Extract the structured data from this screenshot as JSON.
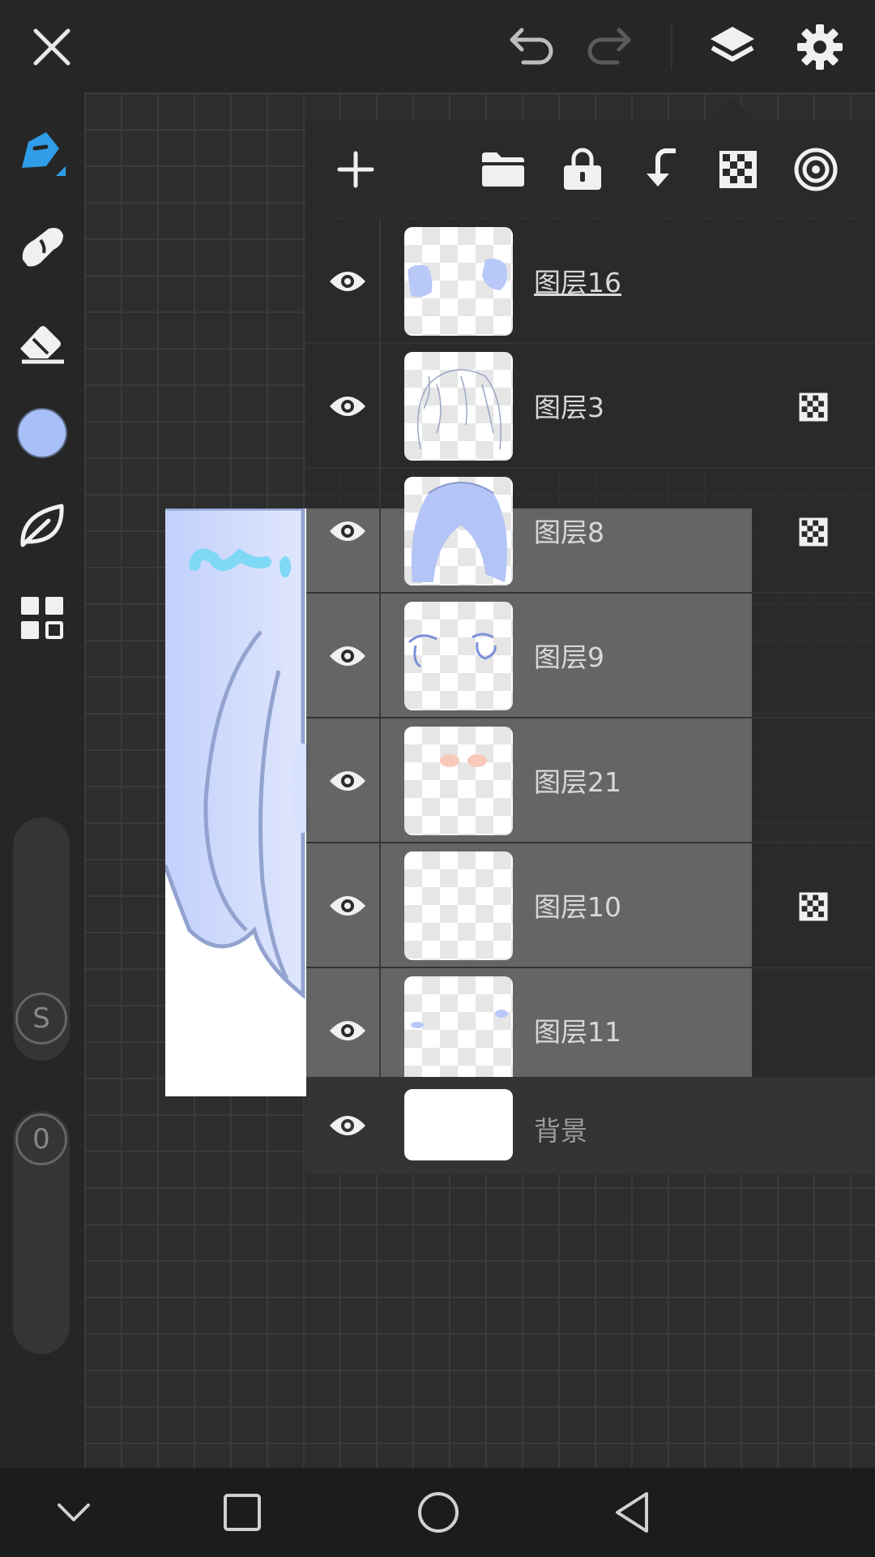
{
  "colors": {
    "accent": "#2f9de8",
    "current_color": "#a8bff7",
    "panel_bg": "#2a2a2a",
    "background": "#2d2d2d"
  },
  "topbar": {
    "icons": [
      "close-icon",
      "undo-icon",
      "redo-icon",
      "layers-icon",
      "settings-icon"
    ]
  },
  "left_toolbar": {
    "tools": [
      "pen-icon",
      "smudge-icon",
      "eraser-icon",
      "color-swatch",
      "leaf-icon",
      "grid-icon"
    ],
    "size_slider_label": "S",
    "opacity_slider_label": "0"
  },
  "layers_panel": {
    "toolbar_icons": [
      "add-layer-icon",
      "folder-icon",
      "lock-icon",
      "merge-down-icon",
      "alpha-lock-icon",
      "blend-icon"
    ],
    "layers": [
      {
        "name": "图层16",
        "selected": true,
        "alpha_lock": false
      },
      {
        "name": "图层3",
        "selected": false,
        "alpha_lock": true
      },
      {
        "name": "图层8",
        "selected": false,
        "alpha_lock": true
      },
      {
        "name": "图层9",
        "selected": false,
        "alpha_lock": false
      },
      {
        "name": "图层21",
        "selected": false,
        "alpha_lock": false
      },
      {
        "name": "图层10",
        "selected": false,
        "alpha_lock": true
      },
      {
        "name": "图层11",
        "selected": false,
        "alpha_lock": false
      }
    ],
    "background_layer": {
      "name": "背景"
    }
  },
  "navbar": {
    "icons": [
      "collapse-icon",
      "recents-icon",
      "home-icon",
      "back-icon"
    ]
  }
}
